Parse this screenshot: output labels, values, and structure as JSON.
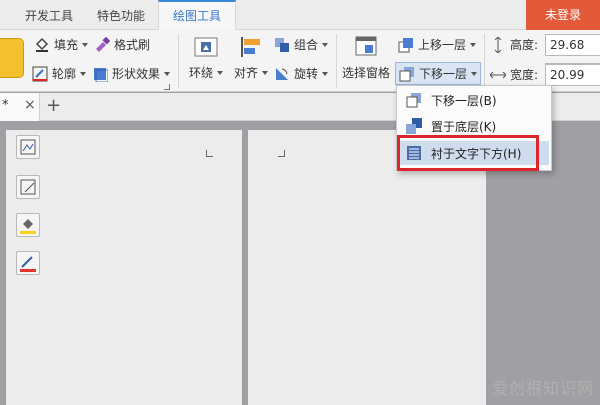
{
  "tabs": [
    {
      "label": "开发工具",
      "active": false
    },
    {
      "label": "特色功能",
      "active": false
    },
    {
      "label": "绘图工具",
      "active": true
    }
  ],
  "login": "未登录",
  "ribbon": {
    "fill": "填充",
    "format_brush": "格式刷",
    "outline": "轮廓",
    "shape_effects": "形状效果",
    "wrap": "环绕",
    "align": "对齐",
    "group": "组合",
    "rotate": "旋转",
    "selection_pane": "选择窗格",
    "bring_forward": "上移一层",
    "send_backward": "下移一层",
    "height_label": "高度:",
    "height_value": "29.68",
    "width_label": "宽度:",
    "width_value": "20.99"
  },
  "doc_tab": {
    "title": "*",
    "close": "×",
    "add": "+"
  },
  "dropdown": {
    "items": [
      {
        "label": "下移一层(B)"
      },
      {
        "label": "置于底层(K)"
      },
      {
        "label": "衬于文字下方(H)"
      }
    ]
  },
  "watermark": "爱创根知识网",
  "colors": {
    "accent": "#3c86d6",
    "login_bg": "#e25a3a",
    "highlight_box": "#d9262c"
  }
}
